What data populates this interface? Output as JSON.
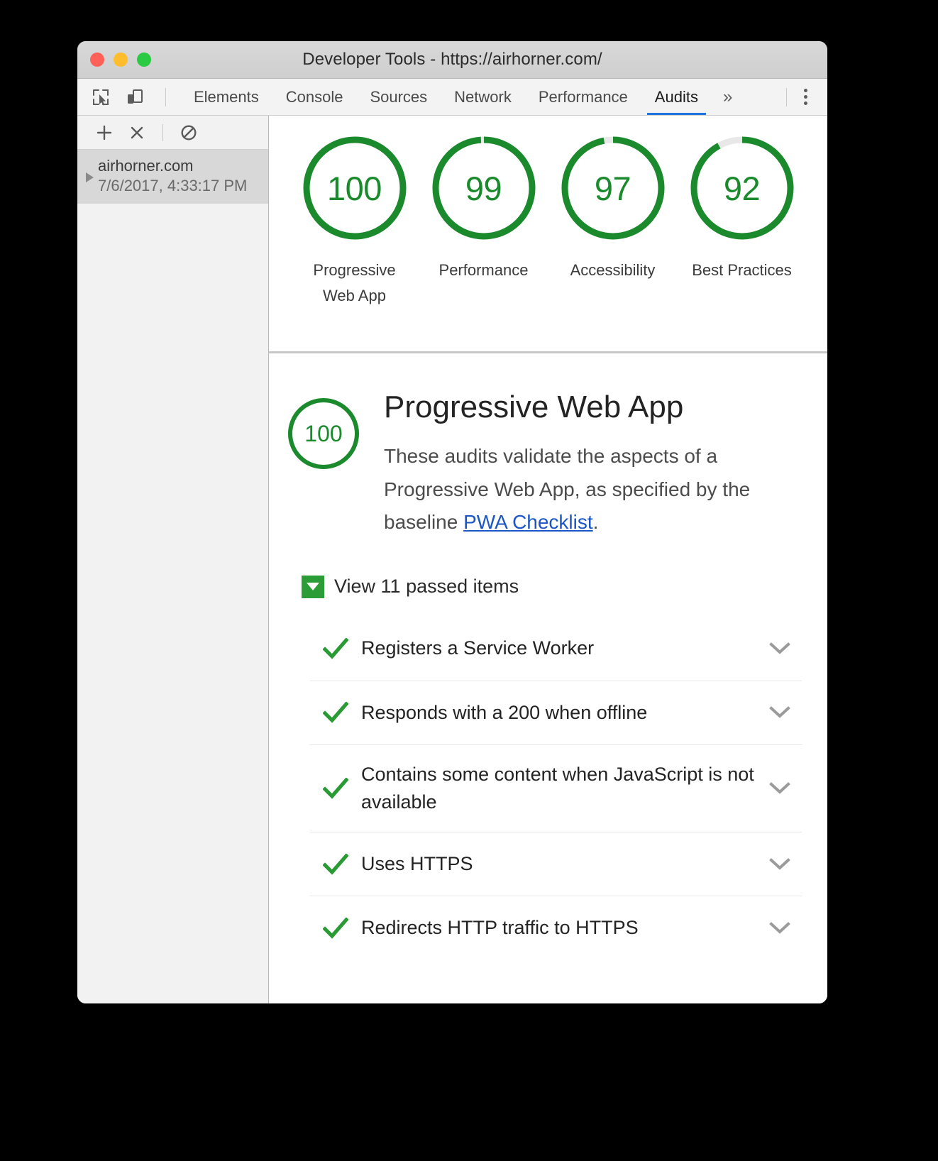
{
  "window": {
    "title": "Developer Tools - https://airhorner.com/",
    "traffic_lights": [
      "close",
      "minimize",
      "maximize"
    ]
  },
  "tabbar": {
    "inspect_icon": "inspect-element-icon",
    "device_icon": "device-toolbar-icon",
    "tabs": [
      {
        "label": "Elements",
        "active": false
      },
      {
        "label": "Console",
        "active": false
      },
      {
        "label": "Sources",
        "active": false
      },
      {
        "label": "Network",
        "active": false
      },
      {
        "label": "Performance",
        "active": false
      },
      {
        "label": "Audits",
        "active": true
      }
    ],
    "more_tabs": "»",
    "menu_icon": "kebab-menu-icon"
  },
  "sidebar": {
    "toolbar": {
      "add_label": "+",
      "delete_label": "×",
      "clear_label": "clear-icon"
    },
    "items": [
      {
        "host": "airhorner.com",
        "timestamp": "7/6/2017, 4:33:17 PM",
        "selected": true
      }
    ]
  },
  "scores": [
    {
      "value": "100",
      "score": 100,
      "label": "Progressive Web App",
      "color": "#1a8a2c"
    },
    {
      "value": "99",
      "score": 99,
      "label": "Performance",
      "color": "#1a8a2c"
    },
    {
      "value": "97",
      "score": 97,
      "label": "Accessibility",
      "color": "#1a8a2c"
    },
    {
      "value": "92",
      "score": 92,
      "label": "Best Practices",
      "color": "#1a8a2c"
    }
  ],
  "detail": {
    "score_value": "100",
    "score": 100,
    "title": "Progressive Web App",
    "description_before": "These audits validate the aspects of a Progressive Web App, as specified by the baseline ",
    "link_text": "PWA Checklist",
    "description_after": ".",
    "passed_toggle_label": "View 11 passed items",
    "passed_count": 11,
    "audits": [
      {
        "title": "Registers a Service Worker",
        "status": "pass"
      },
      {
        "title": "Responds with a 200 when offline",
        "status": "pass"
      },
      {
        "title": "Contains some content when JavaScript is not available",
        "status": "pass"
      },
      {
        "title": "Uses HTTPS",
        "status": "pass"
      },
      {
        "title": "Redirects HTTP traffic to HTTPS",
        "status": "pass"
      }
    ]
  },
  "colors": {
    "pass_green": "#2a9a34",
    "gauge_green": "#1a8a2c",
    "link_blue": "#1a56c6",
    "active_tab_underline": "#1f74e0"
  }
}
